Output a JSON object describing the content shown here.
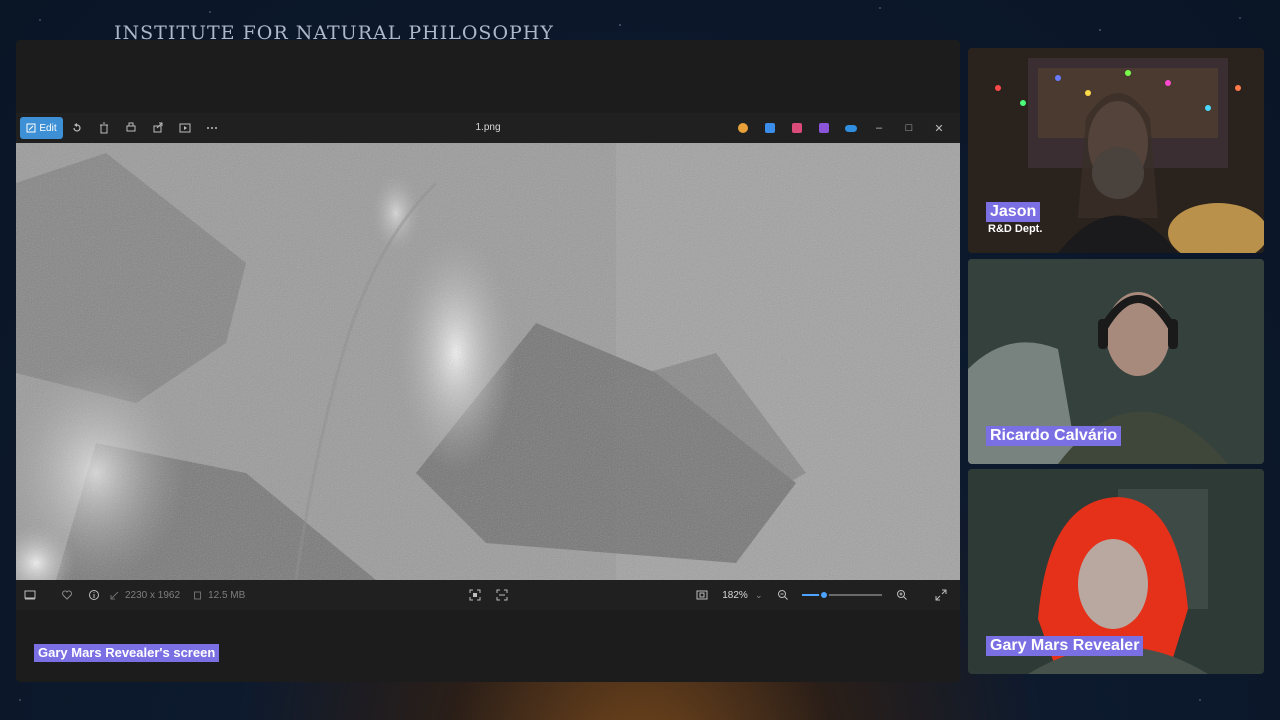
{
  "brand": {
    "title": "INSTITUTE FOR NATURAL PHILOSOPHY"
  },
  "viewer": {
    "edit_label": "Edit",
    "file_name": "1.png",
    "dimensions": "2230 x 1962",
    "file_size": "12.5 MB",
    "zoom": "182%",
    "zoom_fraction": 0.28,
    "toolbar_icons": [
      "rotate-icon",
      "delete-icon",
      "print-icon",
      "share-icon",
      "slideshow-icon",
      "more-icon"
    ],
    "app_icons": [
      {
        "name": "copilot-icon",
        "color": "#e8a13a"
      },
      {
        "name": "designer-icon",
        "color": "#3a8de8"
      },
      {
        "name": "clipchamp-icon",
        "color": "#d94c7a"
      },
      {
        "name": "onenote-icon",
        "color": "#8a55d6"
      },
      {
        "name": "onedrive-icon",
        "color": "#2f8ee0"
      }
    ]
  },
  "share": {
    "label": "Gary Mars Revealer's screen"
  },
  "participants": [
    {
      "name": "Jason",
      "role": "R&D Dept."
    },
    {
      "name": "Ricardo Calvário"
    },
    {
      "name": "Gary Mars Revealer"
    }
  ],
  "colors": {
    "badge": "#7b70e3",
    "accent": "#3d8fd6",
    "slider": "#4da3ff"
  }
}
